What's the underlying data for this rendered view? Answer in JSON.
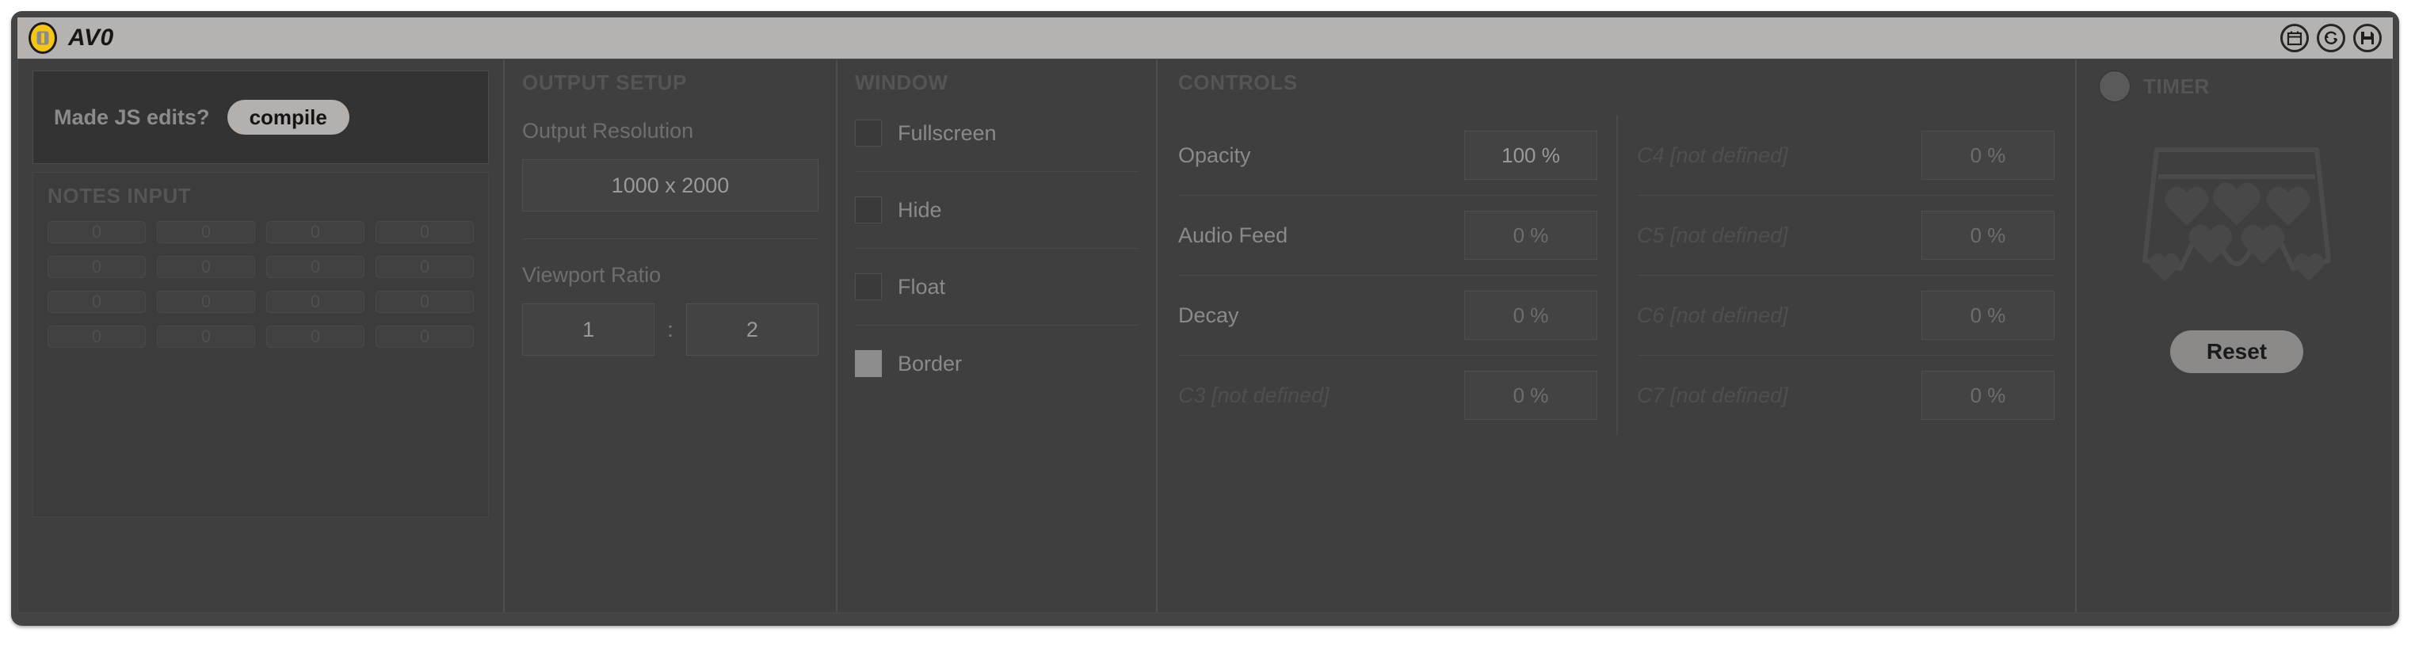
{
  "titlebar": {
    "title": "AV0",
    "power_icon": "power-indicator-icon",
    "icons": [
      {
        "name": "calendar-icon"
      },
      {
        "name": "refresh-icon"
      },
      {
        "name": "save-icon"
      }
    ]
  },
  "js_edits": {
    "prompt": "Made JS edits?",
    "compile_label": "compile"
  },
  "notes_input": {
    "title": "NOTES INPUT",
    "cells": [
      "0",
      "0",
      "0",
      "0",
      "0",
      "0",
      "0",
      "0",
      "0",
      "0",
      "0",
      "0",
      "0",
      "0",
      "0",
      "0"
    ]
  },
  "output_setup": {
    "title": "OUTPUT SETUP",
    "resolution_label": "Output Resolution",
    "resolution_value": "1000 x 2000",
    "ratio_label": "Viewport Ratio",
    "ratio_w": "1",
    "ratio_sep": ":",
    "ratio_h": "2"
  },
  "window": {
    "title": "WINDOW",
    "options": [
      {
        "label": "Fullscreen",
        "checked": false
      },
      {
        "label": "Hide",
        "checked": false
      },
      {
        "label": "Float",
        "checked": false
      },
      {
        "label": "Border",
        "checked": true
      }
    ]
  },
  "controls": {
    "title": "CONTROLS",
    "left": [
      {
        "name": "Opacity",
        "value": "100 %",
        "defined": true
      },
      {
        "name": "Audio Feed",
        "value": "0 %",
        "defined": true
      },
      {
        "name": "Decay",
        "value": "0 %",
        "defined": true
      },
      {
        "name": "C3 [not defined]",
        "value": "0 %",
        "defined": false
      }
    ],
    "right": [
      {
        "name": "C4 [not defined]",
        "value": "0 %",
        "defined": false
      },
      {
        "name": "C5 [not defined]",
        "value": "0 %",
        "defined": false
      },
      {
        "name": "C6 [not defined]",
        "value": "0 %",
        "defined": false
      },
      {
        "name": "C7 [not defined]",
        "value": "0 %",
        "defined": false
      }
    ]
  },
  "timer": {
    "title": "TIMER",
    "toggle_on": false,
    "icon": "boxer-shorts-hearts-icon",
    "reset_label": "Reset"
  },
  "colors": {
    "accent_yellow": "#f5c518",
    "titlebar_bg": "#b5b2b0",
    "window_bg": "#3f3f3f",
    "panel_bg": "#333333",
    "text_muted": "#8a8a8a",
    "text_dim": "#4f4f4f"
  }
}
